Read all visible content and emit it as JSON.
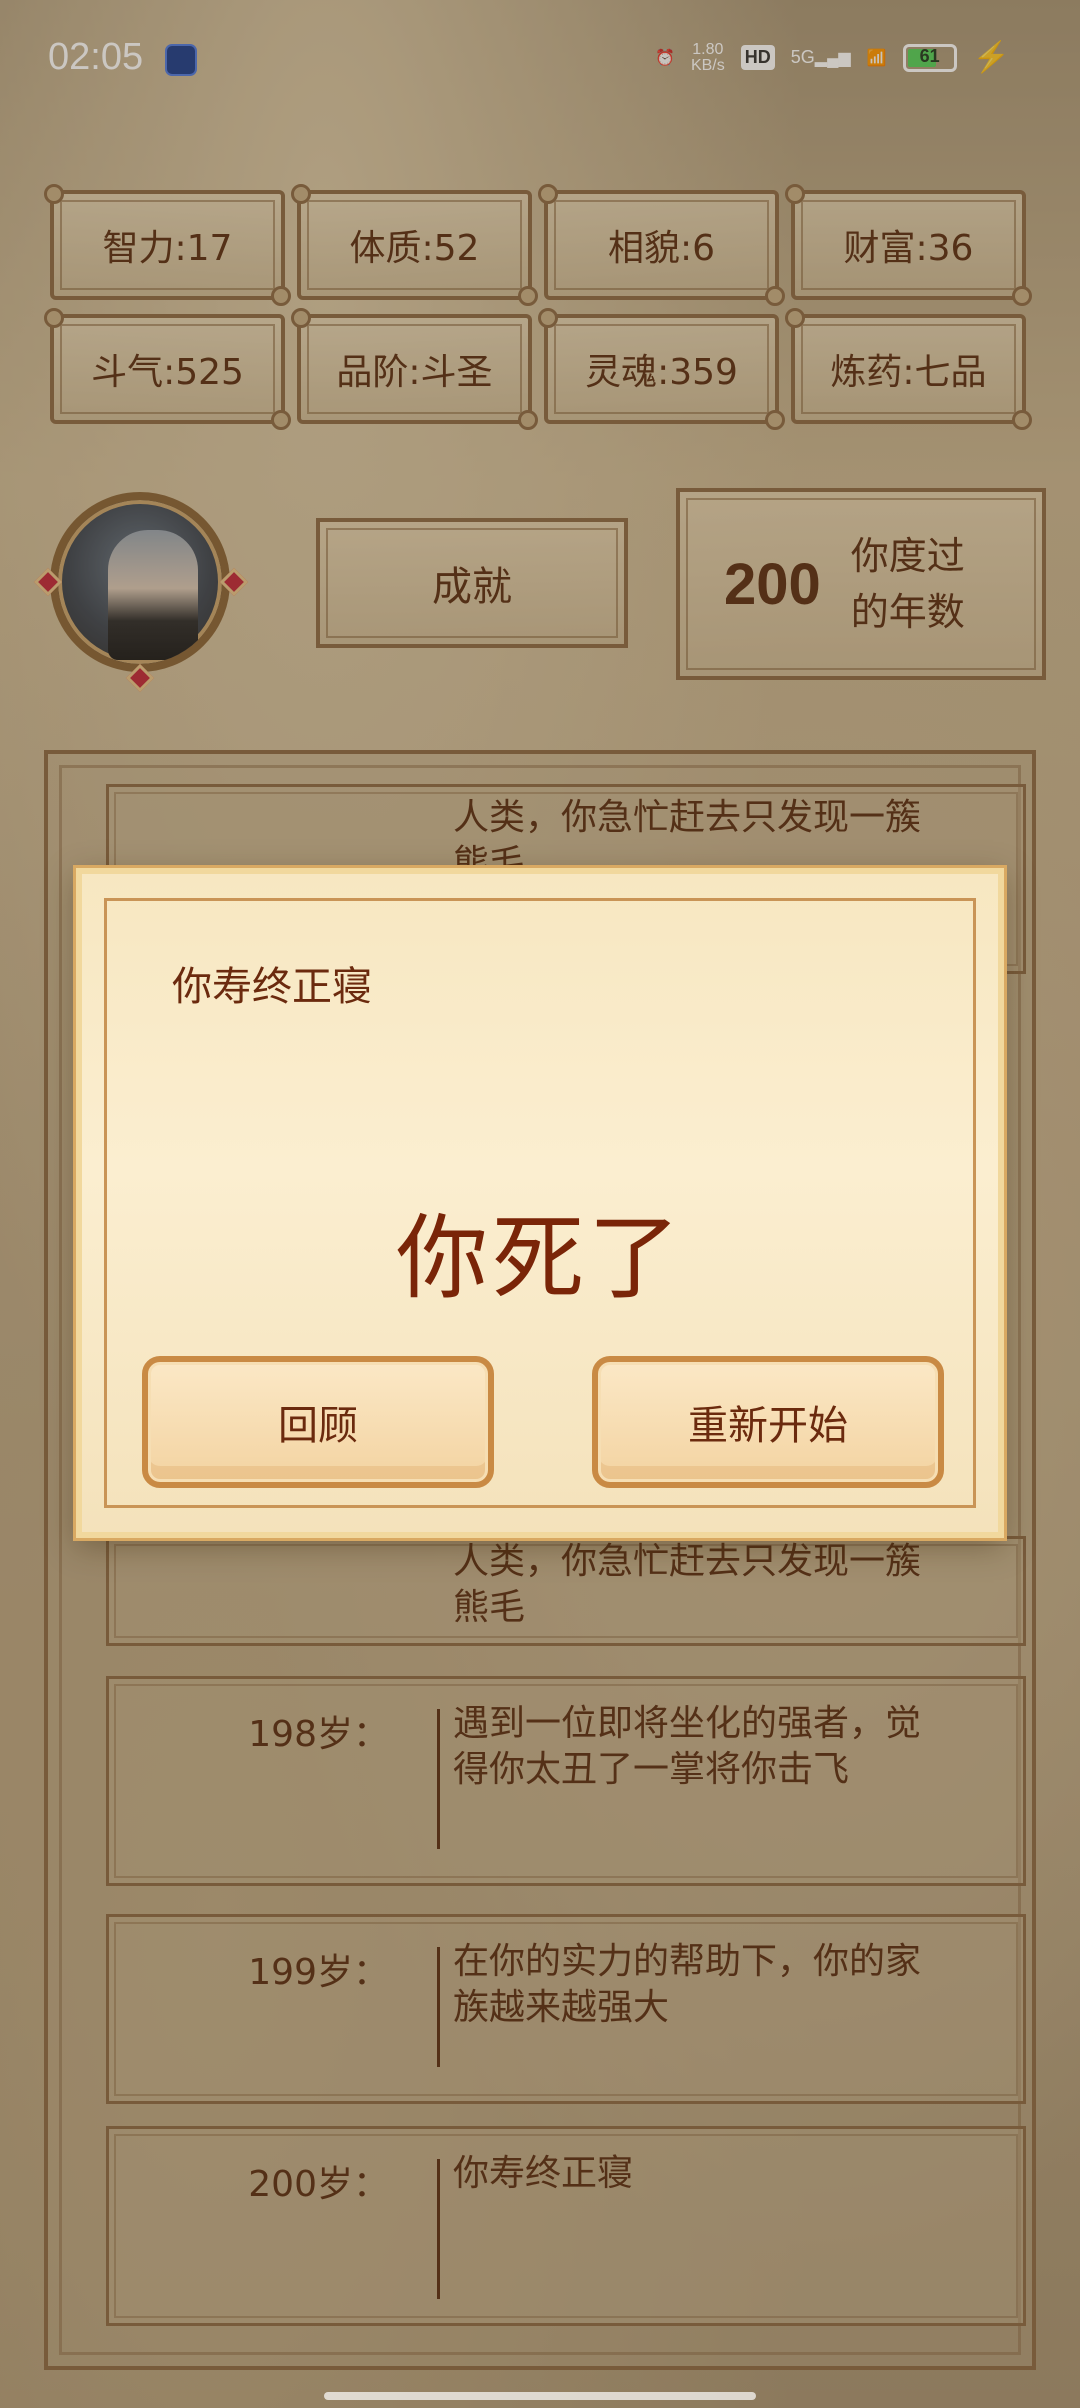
{
  "status_bar": {
    "time": "02:05",
    "net_speed_value": "1.80",
    "net_speed_unit": "KB/s",
    "hd": "HD",
    "signal": "5G",
    "battery": "61"
  },
  "stats": [
    {
      "label": "智力:17"
    },
    {
      "label": "体质:52"
    },
    {
      "label": "相貌:6"
    },
    {
      "label": "财富:36"
    },
    {
      "label": "斗气:525"
    },
    {
      "label": "品阶:斗圣"
    },
    {
      "label": "灵魂:359"
    },
    {
      "label": "炼药:七品"
    }
  ],
  "achievements_button": "成就",
  "years": {
    "value": "200",
    "label": "你度过的年数"
  },
  "log": [
    {
      "age": "",
      "text": "人类，你急忙赶去只发现一簇熊毛"
    },
    {
      "age": "198岁：",
      "text": "遇到一位即将坐化的强者，觉得你太丑了一掌将你击飞"
    },
    {
      "age": "199岁：",
      "text": "在你的实力的帮助下，你的家族越来越强大"
    },
    {
      "age": "200岁：",
      "text": "你寿终正寝"
    }
  ],
  "modal": {
    "subtitle": "你寿终正寝",
    "title": "你死了",
    "review_button": "回顾",
    "restart_button": "重新开始"
  }
}
